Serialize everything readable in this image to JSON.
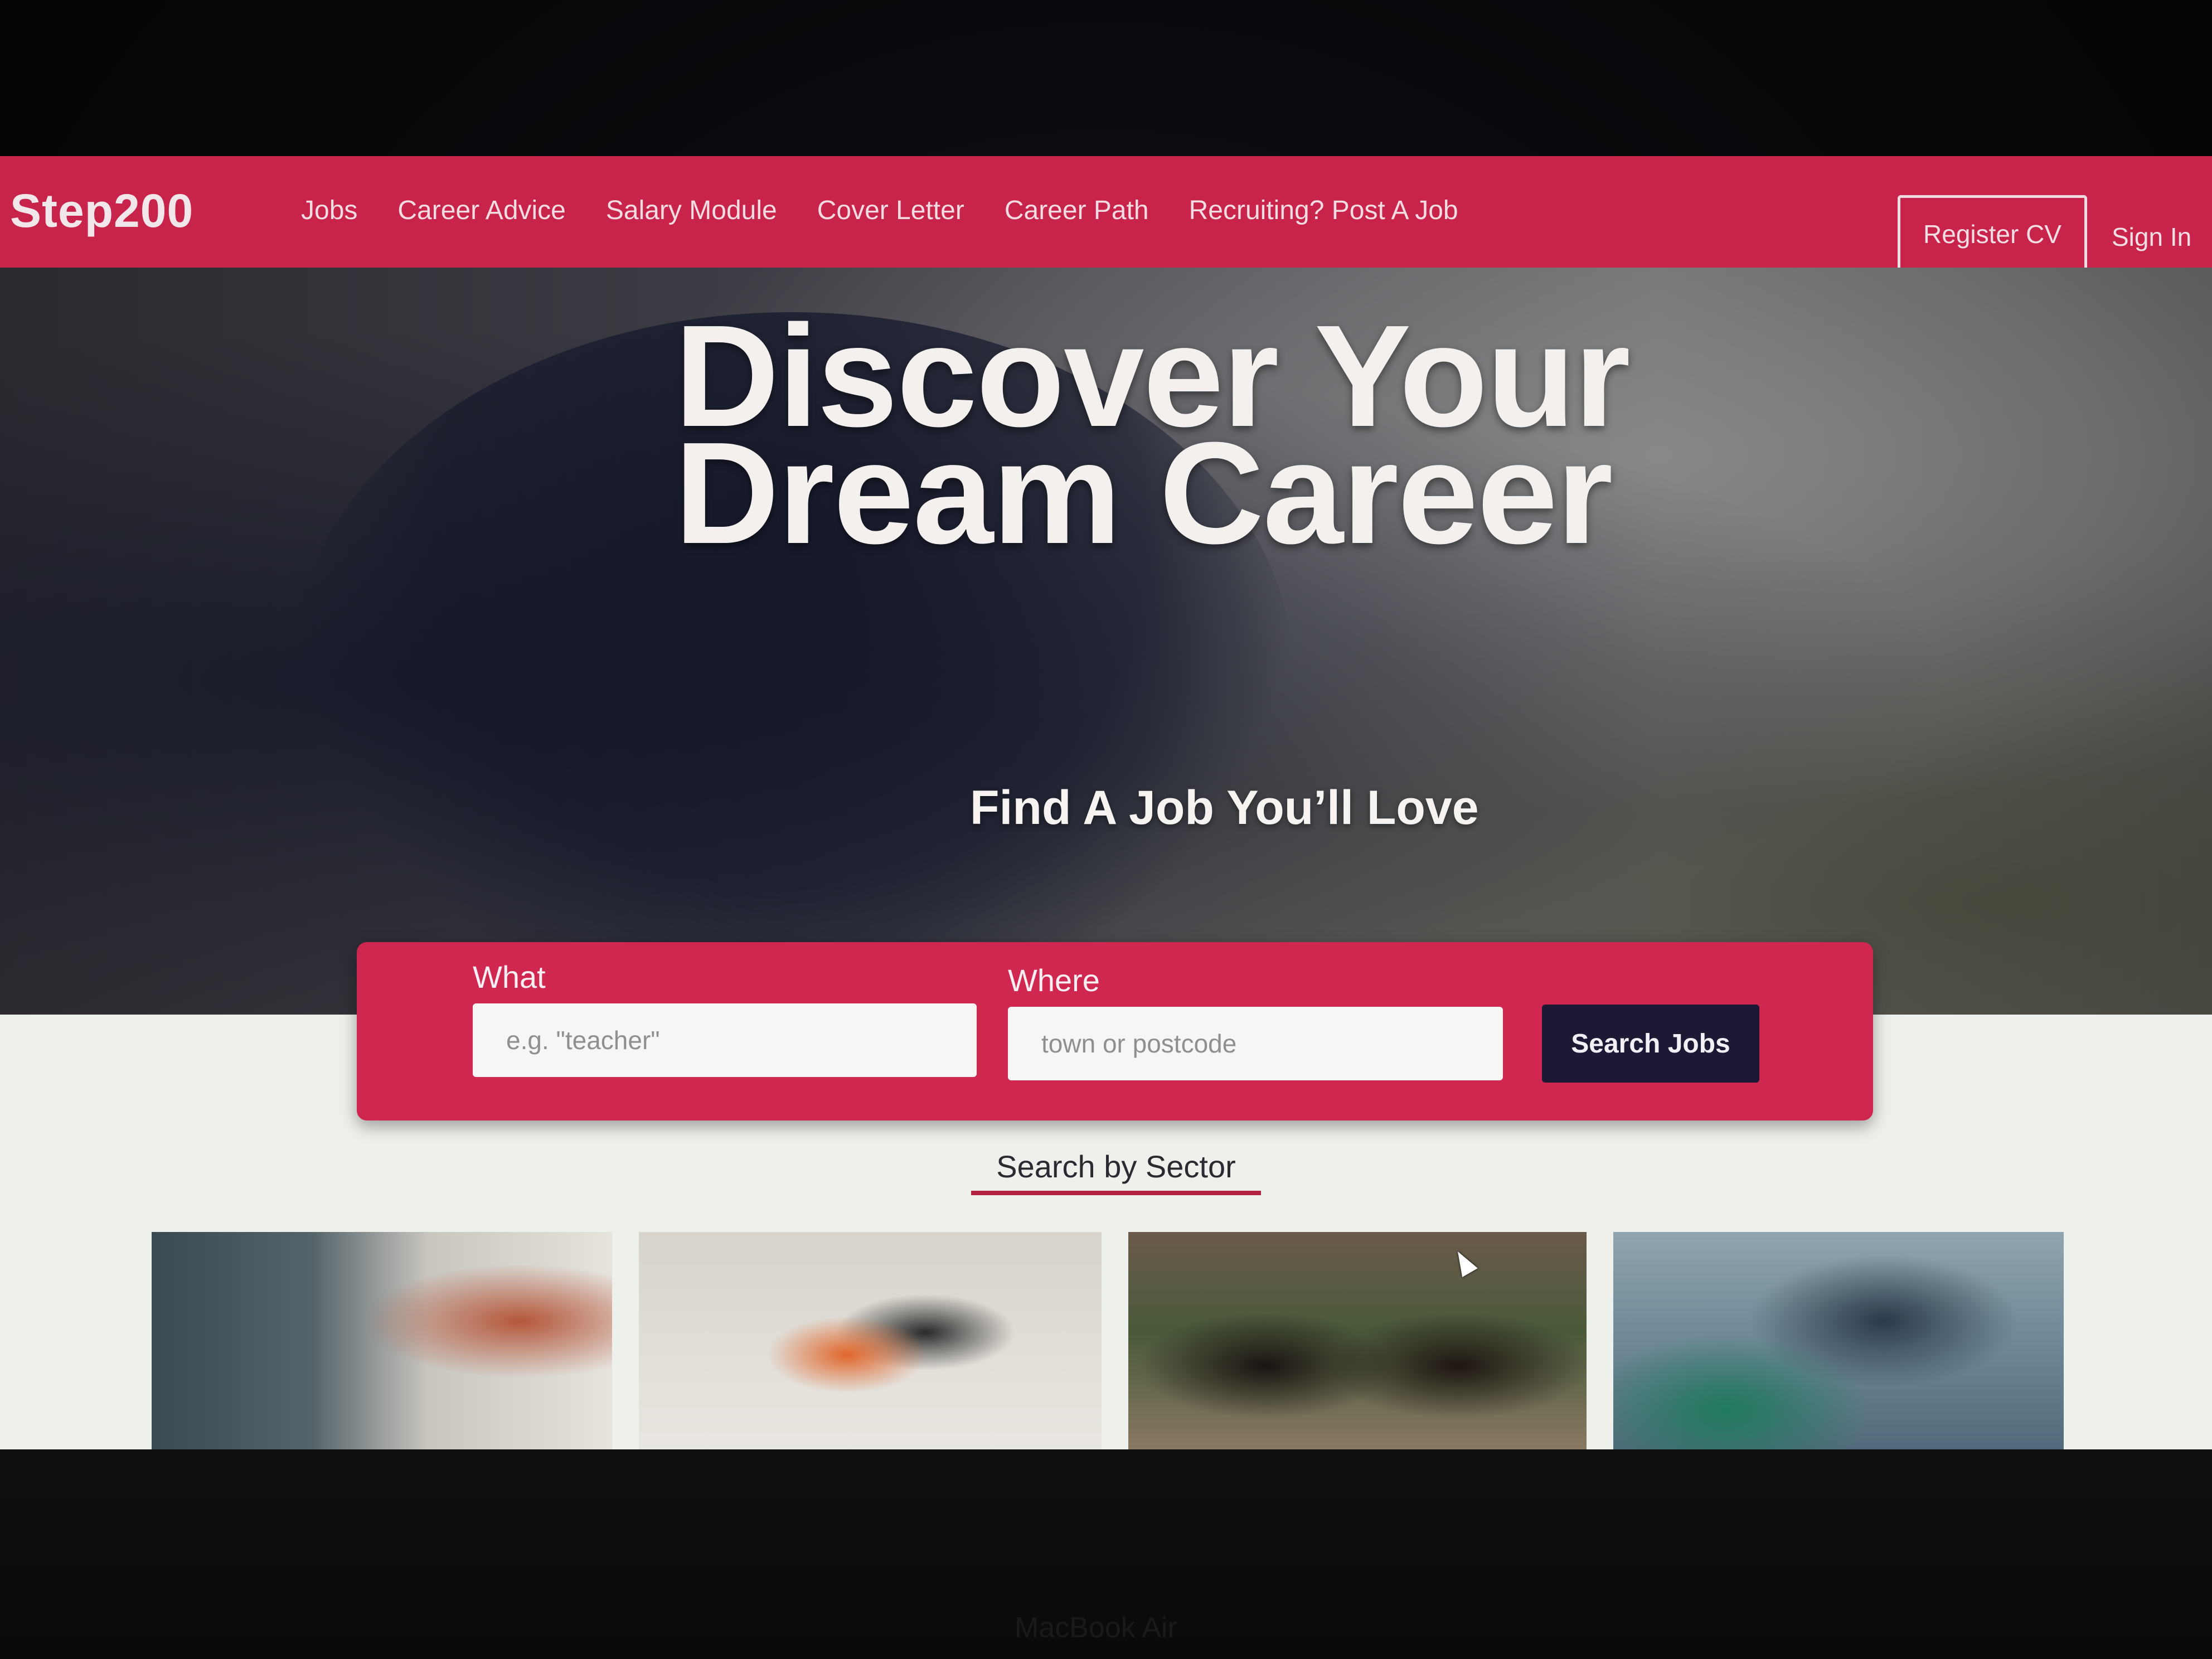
{
  "navbar": {
    "logo": "Step200",
    "links": [
      "Jobs",
      "Career Advice",
      "Salary Module",
      "Cover Letter",
      "Career Path",
      "Recruiting? Post A Job"
    ],
    "register_label": "Register CV",
    "signin_label": "Sign In"
  },
  "hero": {
    "title_line1": "Discover Your",
    "title_line2": "Dream Career",
    "subtitle": "Find A Job You’ll Love"
  },
  "search": {
    "what_label": "What",
    "what_placeholder": "e.g. \"teacher\"",
    "where_label": "Where",
    "where_placeholder": "town or postcode",
    "button_label": "Search Jobs"
  },
  "sectors": {
    "heading": "Search by Sector",
    "cards": [
      "it-sector",
      "construction-sector",
      "education-sector",
      "healthcare-sector"
    ]
  },
  "device": {
    "brand": "MacBook Air"
  },
  "colors": {
    "brand": "#c8234a",
    "search_panel": "#cf2750",
    "search_button": "#1c1934",
    "underline": "#b3233f"
  }
}
